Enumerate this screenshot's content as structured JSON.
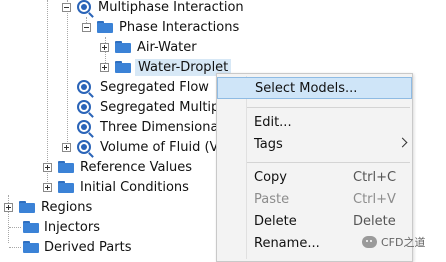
{
  "tree": {
    "multiphase_interaction": "Multiphase Interaction",
    "phase_interactions": "Phase Interactions",
    "air_water": "Air-Water",
    "water_droplet": "Water-Droplet",
    "segregated_flow": "Segregated Flow",
    "segregated_multiphase": "Segregated Multip",
    "three_dimensional": "Three Dimensional",
    "volume_of_fluid": "Volume of Fluid (V",
    "reference_values": "Reference Values",
    "initial_conditions": "Initial Conditions",
    "regions": "Regions",
    "injectors": "Injectors",
    "derived_parts": "Derived Parts"
  },
  "context_menu": {
    "select_models": "Select Models...",
    "edit": "Edit...",
    "tags": "Tags",
    "copy": "Copy",
    "copy_shortcut": "Ctrl+C",
    "paste": "Paste",
    "paste_shortcut": "Ctrl+V",
    "delete": "Delete",
    "delete_shortcut": "Delete",
    "rename": "Rename..."
  },
  "watermark": {
    "text": "CFD之道"
  }
}
